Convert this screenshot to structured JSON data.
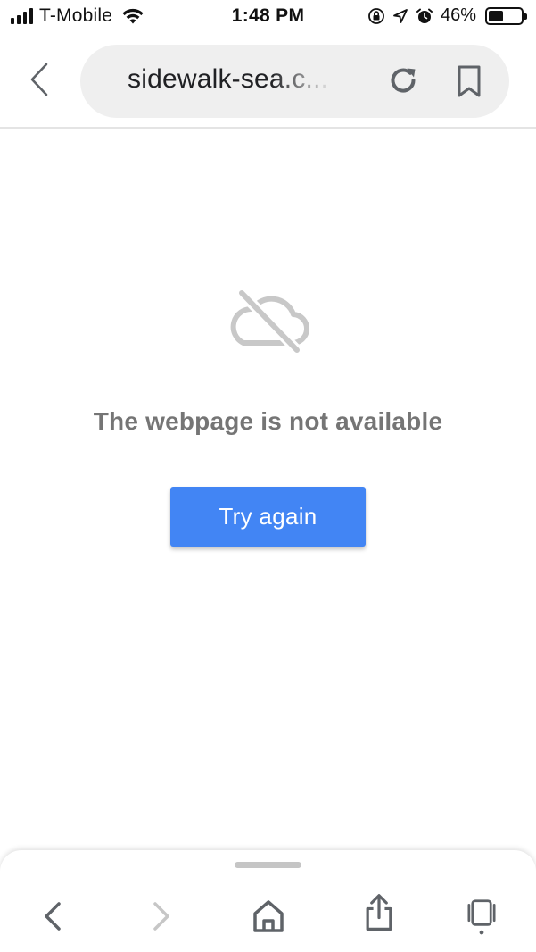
{
  "status_bar": {
    "carrier": "T-Mobile",
    "time": "1:48 PM",
    "battery_percent": "46%",
    "battery_level": 0.46,
    "signal_bars": 4,
    "icons": [
      "wifi-icon",
      "orientation-lock-icon",
      "location-icon",
      "alarm-icon",
      "battery-icon"
    ]
  },
  "toolbar": {
    "url": "sidewalk-sea.c..."
  },
  "error": {
    "message": "The webpage is not available",
    "button_label": "Try again",
    "icon": "cloud-off-icon"
  },
  "colors": {
    "accent": "#4285f4",
    "message_text": "#757575",
    "omnibox_bg": "#efefef",
    "icon_gray": "#5f6368",
    "disabled_gray": "#c6c6c6"
  }
}
